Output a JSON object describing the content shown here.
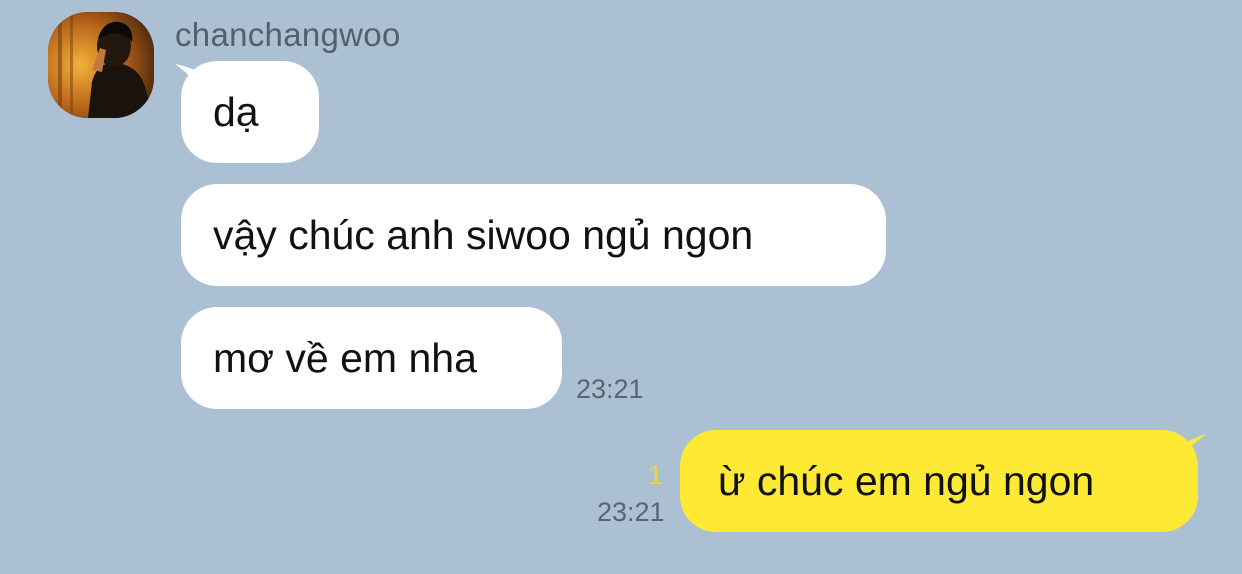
{
  "conversation": {
    "sender_name": "chanchangwoo",
    "avatar_icon": "profile-photo-avatar",
    "incoming": [
      {
        "text": "dạ"
      },
      {
        "text": "vậy chúc anh siwoo ngủ ngon"
      },
      {
        "text": "mơ về em nha"
      }
    ],
    "incoming_time": "23:21",
    "outgoing": {
      "text": "ừ chúc em ngủ ngon",
      "time": "23:21",
      "unread_count": "1"
    }
  },
  "colors": {
    "background": "#abc0d3",
    "incoming_bubble": "#ffffff",
    "outgoing_bubble": "#fee934",
    "unread": "#f2d43a",
    "timestamp": "#5a6470"
  }
}
